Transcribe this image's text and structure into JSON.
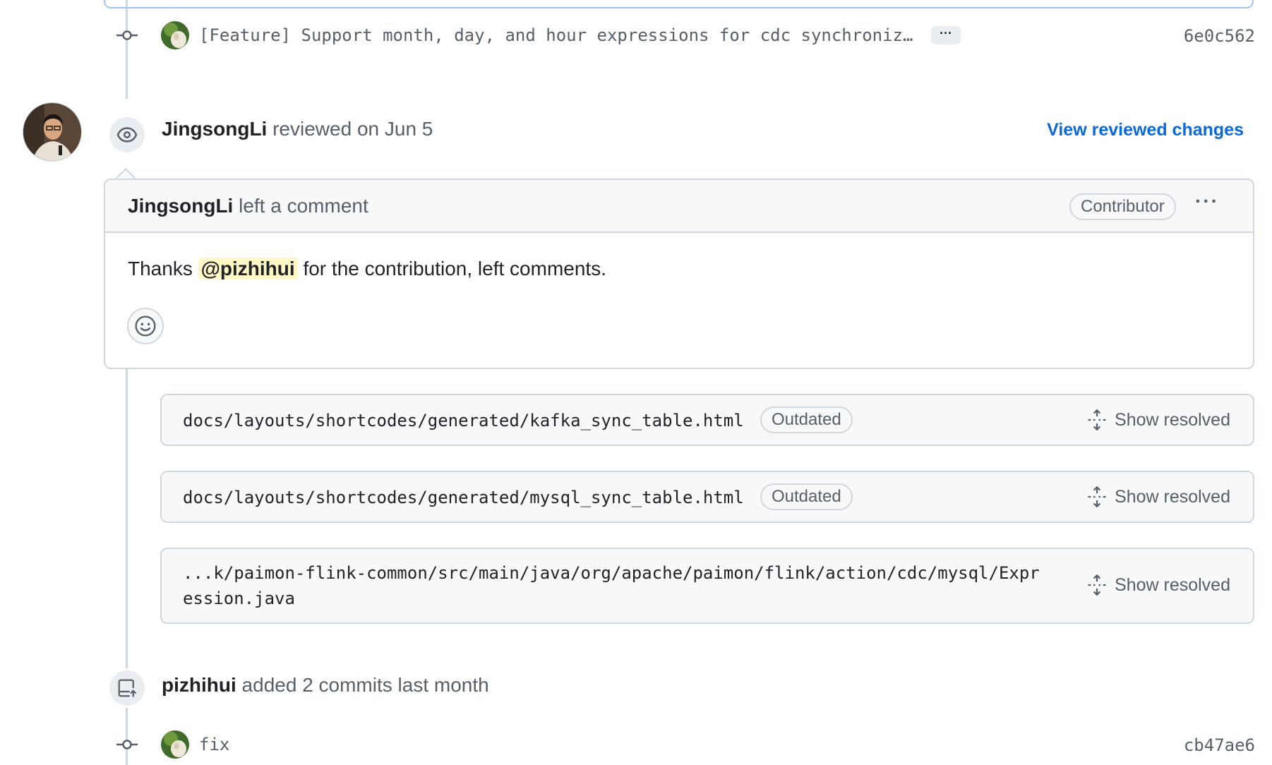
{
  "top_commit": {
    "message": "[Feature] Support month, day, and hour expressions for cdc synchroniz…",
    "expand_label": "···",
    "sha": "6e0c562"
  },
  "review": {
    "author": "JingsongLi",
    "action": "reviewed on Jun 5",
    "view_changes_label": "View reviewed changes"
  },
  "comment": {
    "author": "JingsongLi",
    "action": "left a comment",
    "role_badge": "Contributor",
    "menu_label": "···",
    "body_prefix": "Thanks",
    "mention": "@pizhihui",
    "body_suffix": "for the contribution, left comments."
  },
  "threads": [
    {
      "path": "docs/layouts/shortcodes/generated/kafka_sync_table.html",
      "badge": "Outdated",
      "action": "Show resolved"
    },
    {
      "path": "docs/layouts/shortcodes/generated/mysql_sync_table.html",
      "badge": "Outdated",
      "action": "Show resolved"
    },
    {
      "path_line1": "...k/paimon-flink-common/src/main/java/org/apache/paimon/flink/action/cdc/mysql/Expr",
      "path_line2": "ession.java",
      "action": "Show resolved"
    }
  ],
  "commits_event": {
    "author": "pizhihui",
    "action": "added 2 commits last month"
  },
  "bottom_commit": {
    "message": "fix",
    "sha": "cb47ae6"
  },
  "colors": {
    "link": "#0969da",
    "border": "#d0d7de",
    "mention_bg": "#fff8c5",
    "muted": "#57606a"
  }
}
